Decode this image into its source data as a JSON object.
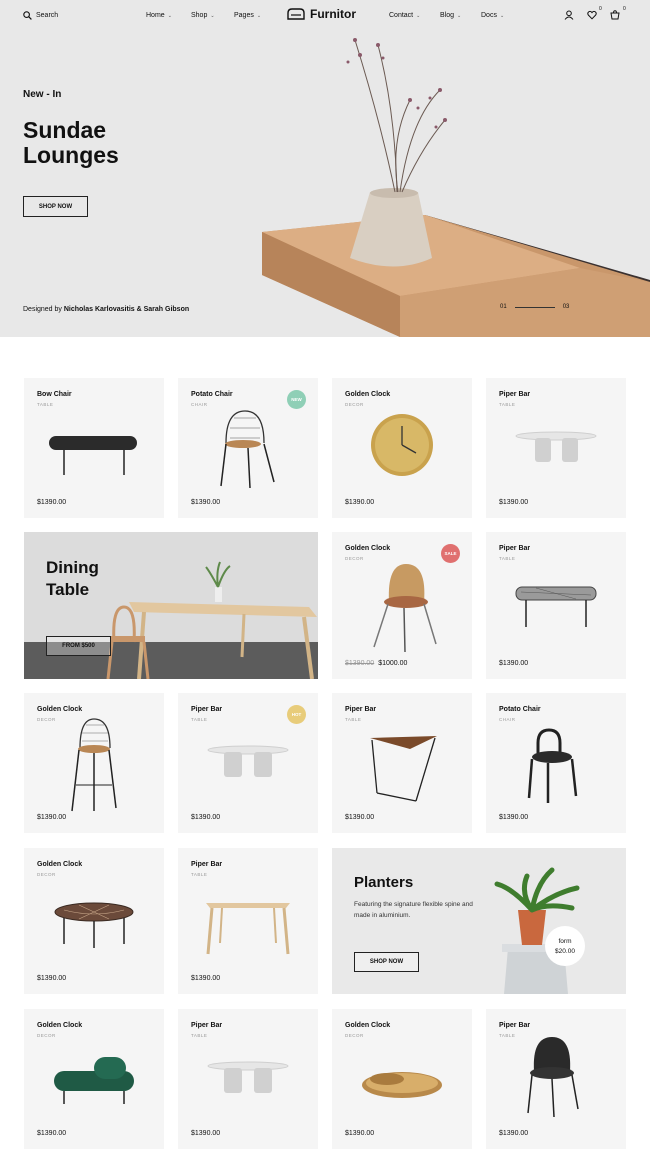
{
  "header": {
    "search_label": "Search",
    "nav_left": [
      "Home",
      "Shop",
      "Pages"
    ],
    "logo": "Furnitor",
    "nav_right": [
      "Contact",
      "Blog",
      "Docs"
    ],
    "wishlist_count": "0",
    "cart_count": "0"
  },
  "hero": {
    "eyebrow": "New - In",
    "title": "Sundae Lounges",
    "button": "SHOP NOW",
    "credit_prefix": "Designed by ",
    "credit_names": "Nicholas Karlovasitis & Sarah Gibson",
    "pager_current": "01",
    "pager_total": "03"
  },
  "products": [
    {
      "name": "Bow Chair",
      "cat": "TABLE",
      "price": "$1390.00"
    },
    {
      "name": "Potato Chair",
      "cat": "CHAIR",
      "price": "$1390.00",
      "badge": "NEW"
    },
    {
      "name": "Golden Clock",
      "cat": "DECOR",
      "price": "$1390.00"
    },
    {
      "name": "Piper Bar",
      "cat": "TABLE",
      "price": "$1390.00"
    },
    {
      "name": "Golden Clock",
      "cat": "DECOR",
      "old_price": "$1390.00",
      "price": "$1000.00",
      "badge": "SALE"
    },
    {
      "name": "Piper Bar",
      "cat": "TABLE",
      "price": "$1390.00"
    },
    {
      "name": "Golden Clock",
      "cat": "DECOR",
      "price": "$1390.00"
    },
    {
      "name": "Piper Bar",
      "cat": "TABLE",
      "price": "$1390.00",
      "badge": "HOT"
    },
    {
      "name": "Piper Bar",
      "cat": "TABLE",
      "price": "$1390.00"
    },
    {
      "name": "Potato Chair",
      "cat": "CHAIR",
      "price": "$1390.00"
    },
    {
      "name": "Golden Clock",
      "cat": "DECOR",
      "price": "$1390.00"
    },
    {
      "name": "Piper Bar",
      "cat": "TABLE",
      "price": "$1390.00"
    },
    {
      "name": "Golden Clock",
      "cat": "DECOR",
      "price": "$1390.00"
    },
    {
      "name": "Piper Bar",
      "cat": "TABLE",
      "price": "$1390.00"
    },
    {
      "name": "Golden Clock",
      "cat": "DECOR",
      "price": "$1390.00"
    },
    {
      "name": "Piper Bar",
      "cat": "TABLE",
      "price": "$1390.00"
    }
  ],
  "promo_dining": {
    "title": "Dining Table",
    "button": "FROM $500"
  },
  "promo_planters": {
    "title": "Planters",
    "desc": "Featuring the signature flexible spine and made in aluminium.",
    "button": "SHOP NOW",
    "price_label": "form",
    "price": "$20.00"
  },
  "colors": {
    "new": "#8fcfb6",
    "sale": "#e0706f",
    "hot": "#e8cc7a"
  }
}
